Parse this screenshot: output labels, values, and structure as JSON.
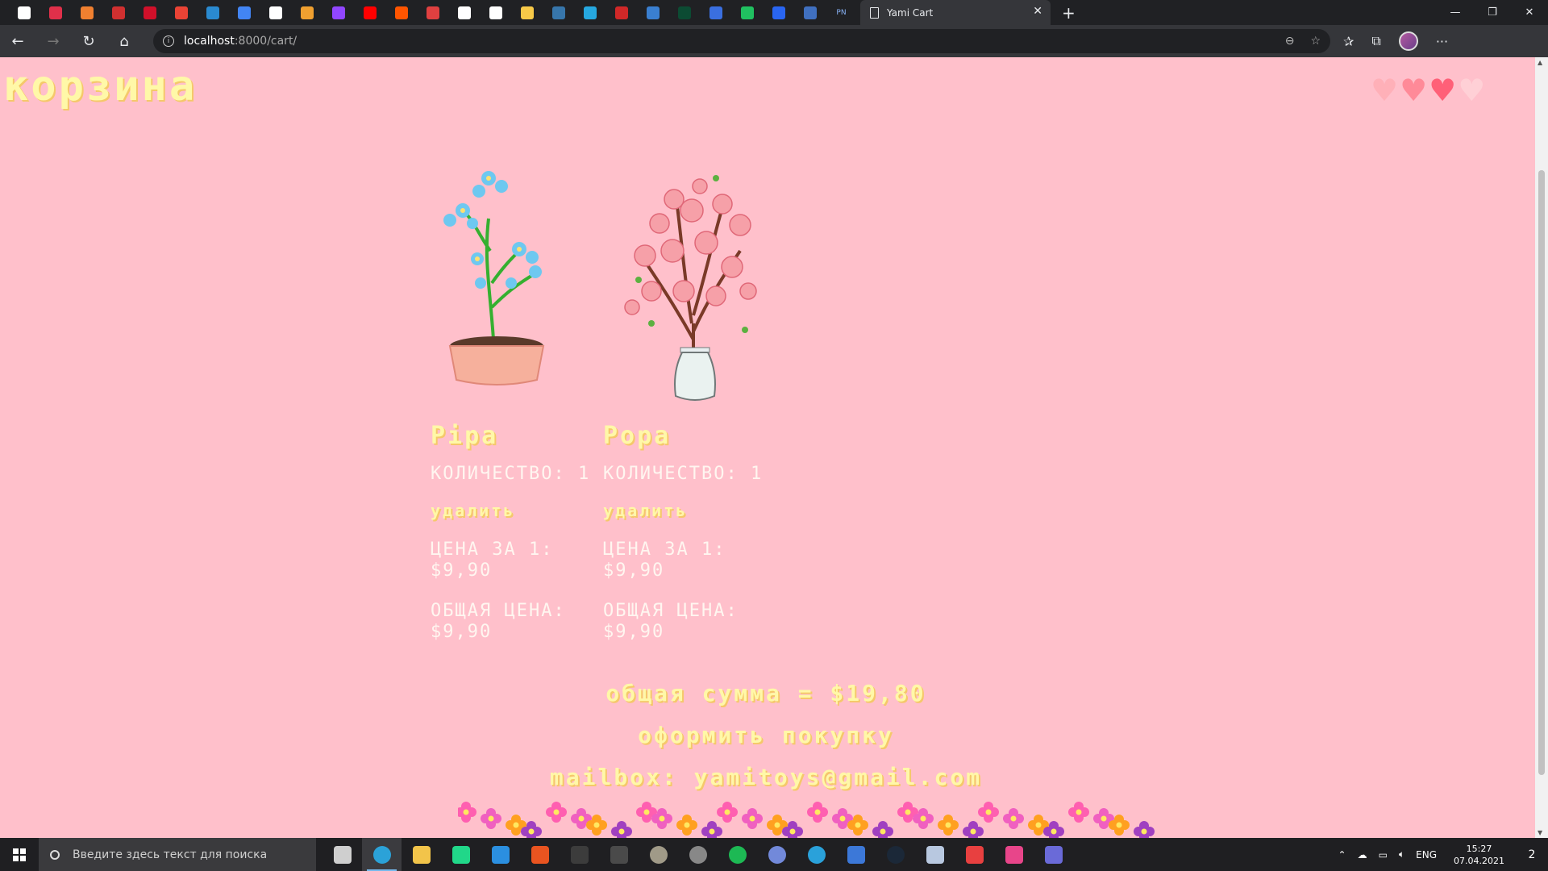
{
  "browser": {
    "tab_title": "Yami Cart",
    "url_host": "localhost",
    "url_path": ":8000/cart/",
    "pinned_tabs": [
      {
        "name": "tab-icon-1",
        "color": "#ffffff"
      },
      {
        "name": "tab-icon-2",
        "color": "#e0304a"
      },
      {
        "name": "tab-icon-3",
        "color": "#f08030"
      },
      {
        "name": "tab-icon-4",
        "color": "#d03030"
      },
      {
        "name": "tab-icon-5",
        "color": "#d0102a"
      },
      {
        "name": "tab-icon-gmail",
        "color": "#ea4335"
      },
      {
        "name": "tab-icon-7",
        "color": "#2a8ad0"
      },
      {
        "name": "tab-icon-translate",
        "color": "#4285f4"
      },
      {
        "name": "tab-icon-github",
        "color": "#ffffff"
      },
      {
        "name": "tab-icon-10",
        "color": "#f0a030"
      },
      {
        "name": "tab-icon-twitch",
        "color": "#9146ff"
      },
      {
        "name": "tab-icon-youtube",
        "color": "#ff0000"
      },
      {
        "name": "tab-icon-soundcloud",
        "color": "#ff5500"
      },
      {
        "name": "tab-icon-14",
        "color": "#e04040"
      },
      {
        "name": "tab-icon-15",
        "color": "#ffffff"
      },
      {
        "name": "tab-icon-16",
        "color": "#ffffff"
      },
      {
        "name": "tab-icon-python",
        "color": "#f7c948"
      },
      {
        "name": "tab-icon-python-2",
        "color": "#3776ab"
      },
      {
        "name": "tab-icon-19",
        "color": "#26a8e0"
      },
      {
        "name": "tab-icon-20",
        "color": "#d02828"
      },
      {
        "name": "tab-icon-21",
        "color": "#3a7fd0"
      },
      {
        "name": "tab-icon-django",
        "color": "#0c4b33"
      },
      {
        "name": "tab-icon-23",
        "color": "#3a6fe0"
      },
      {
        "name": "tab-icon-24",
        "color": "#20c060"
      },
      {
        "name": "tab-icon-css",
        "color": "#2965f1"
      },
      {
        "name": "tab-icon-26",
        "color": "#4070c0"
      }
    ],
    "last_pinned_label": "PN",
    "zoom_icon": "zoom-out-icon"
  },
  "page": {
    "title": "корзина",
    "hearts": [
      "#ffb0b8",
      "#ff8a98",
      "#ff6078",
      "#ffd0d6"
    ],
    "products": [
      {
        "name": "Pipa",
        "quantity_label": "КОЛИЧЕСТВО:",
        "quantity_value": "1",
        "remove_label": "удалить",
        "unit_price_label": "ЦЕНА ЗА 1:",
        "unit_price_value": "$9,90",
        "total_label": "ОБЩАЯ ЦЕНА:",
        "total_value": "$9,90"
      },
      {
        "name": "Popa",
        "quantity_label": "КОЛИЧЕСТВО:",
        "quantity_value": "1",
        "remove_label": "удалить",
        "unit_price_label": "ЦЕНА ЗА 1:",
        "unit_price_value": "$9,90",
        "total_label": "ОБЩАЯ ЦЕНА:",
        "total_value": "$9,90"
      }
    ],
    "grand_total": "общая сумма = $19,80",
    "checkout_label": "оформить покупку",
    "mailbox": "mailbox: yamitoys@gmail.com"
  },
  "taskbar": {
    "search_placeholder": "Введите здесь текст для поиска",
    "apps": [
      {
        "name": "task-view-icon",
        "color": "#cfcfcf"
      },
      {
        "name": "edge-icon",
        "color": "#2ba2d8"
      },
      {
        "name": "file-explorer-icon",
        "color": "#f2c44a"
      },
      {
        "name": "pycharm-icon",
        "color": "#21d789"
      },
      {
        "name": "vscode-icon",
        "color": "#2b8fe0"
      },
      {
        "name": "ubuntu-icon",
        "color": "#e95420"
      },
      {
        "name": "terminal-icon",
        "color": "#3c3c3c"
      },
      {
        "name": "powershell-icon",
        "color": "#4a4a4a"
      },
      {
        "name": "gimp-icon",
        "color": "#a09a88"
      },
      {
        "name": "unity-icon",
        "color": "#888888"
      },
      {
        "name": "spotify-icon",
        "color": "#1db954"
      },
      {
        "name": "discord-icon",
        "color": "#7289da"
      },
      {
        "name": "telegram-icon",
        "color": "#2aa1da"
      },
      {
        "name": "visual-studio-installer-icon",
        "color": "#3c78d8"
      },
      {
        "name": "steam-icon",
        "color": "#1b2838"
      },
      {
        "name": "virtualbox-icon",
        "color": "#b8c8e0"
      },
      {
        "name": "hand-pointer-icon",
        "color": "#e84040"
      },
      {
        "name": "photo-app-icon",
        "color": "#e8458a"
      },
      {
        "name": "calculator-icon",
        "color": "#6a6ad8"
      }
    ],
    "lang": "ENG",
    "time": "15:27",
    "date": "07.04.2021",
    "notifications": "2"
  }
}
